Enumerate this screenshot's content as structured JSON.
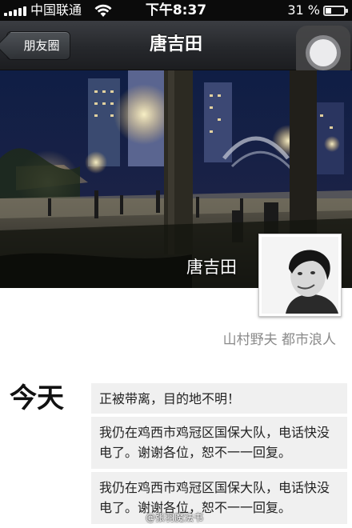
{
  "status_bar": {
    "carrier": "中国联通",
    "time": "下午8:37",
    "battery_percent": "31 %",
    "signal_icon": "signal-bars-icon",
    "wifi_icon": "wifi-icon",
    "battery_icon": "battery-icon"
  },
  "nav": {
    "back_label": "朋友圈",
    "title": "唐吉田"
  },
  "profile": {
    "cover_name": "唐吉田",
    "signature": "山村野夫  都市浪人"
  },
  "timeline": {
    "day_label": "今天",
    "posts": [
      {
        "text": "正被带离，目的地不明！"
      },
      {
        "text": "我仍在鸡西市鸡冠区国保大队，电话快没电了。谢谢各位，恕不一一回复。"
      },
      {
        "text": "我仍在鸡西市鸡冠区国保大队，电话快没电了。谢谢各位，恕不一一回复。"
      }
    ]
  },
  "watermark": "@张羽魔法书",
  "colors": {
    "nav_bg": "#26282c",
    "post_bg": "#f0f0f0",
    "signature": "#8a8a8a"
  }
}
